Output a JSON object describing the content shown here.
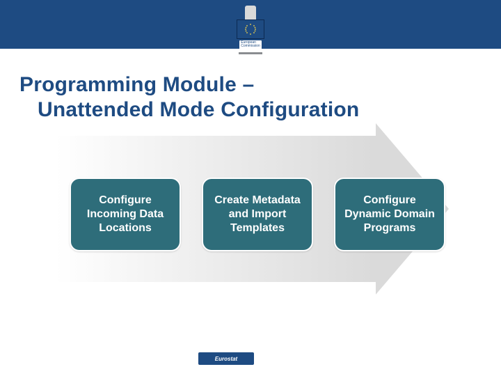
{
  "logo": {
    "text_line1": "European",
    "text_line2": "Commission"
  },
  "title": {
    "line1": "Programming Module –",
    "line2": "Unattended Mode Configuration"
  },
  "steps": [
    {
      "label": "Configure Incoming Data Locations"
    },
    {
      "label": "Create Metadata and Import Templates"
    },
    {
      "label": "Configure Dynamic Domain Programs"
    }
  ],
  "footer": {
    "label": "Eurostat"
  }
}
